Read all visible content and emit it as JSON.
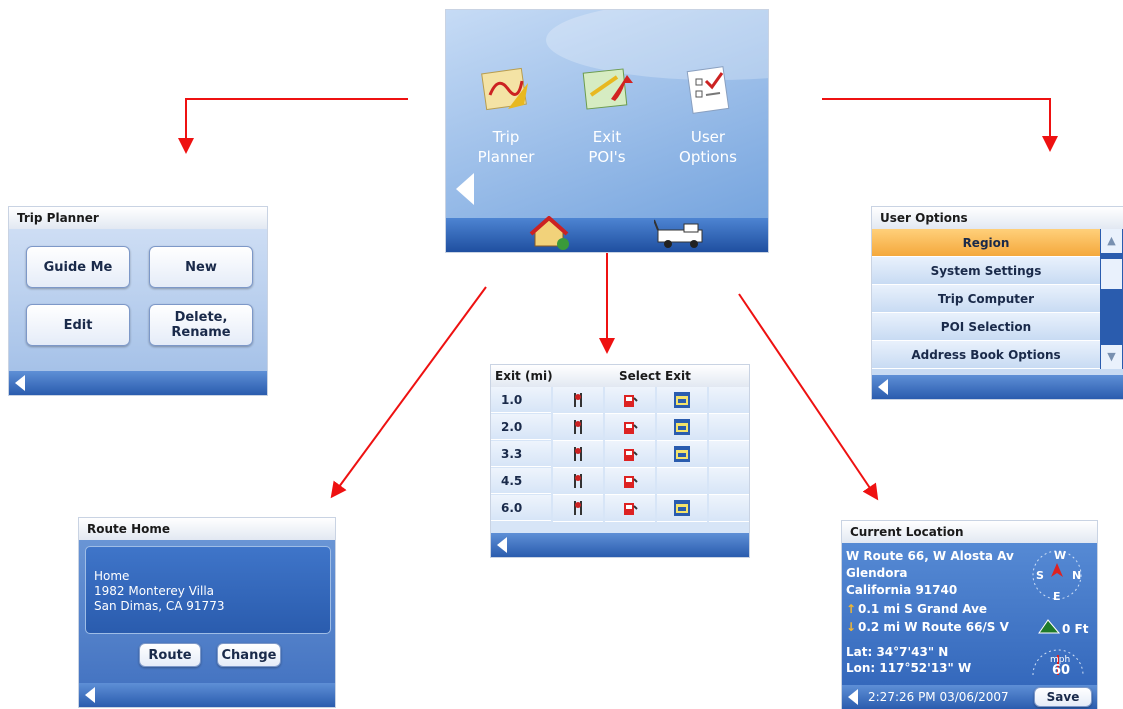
{
  "main_menu": {
    "items": [
      {
        "label": "Trip\nPlanner"
      },
      {
        "label": "Exit\nPOI's"
      },
      {
        "label": "User\nOptions"
      }
    ]
  },
  "trip_planner": {
    "title": "Trip Planner",
    "buttons": [
      "Guide Me",
      "New",
      "Edit",
      "Delete,\nRename"
    ]
  },
  "user_options": {
    "title": "User Options",
    "items": [
      "Region",
      "System Settings",
      "Trip Computer",
      "POI Selection",
      "Address Book Options"
    ]
  },
  "exit_poi": {
    "col_exit": "Exit (mi)",
    "col_select": "Select Exit",
    "rows": [
      {
        "mile": "1.0",
        "food": true,
        "gas": true,
        "lodging": true
      },
      {
        "mile": "2.0",
        "food": true,
        "gas": true,
        "lodging": true
      },
      {
        "mile": "3.3",
        "food": true,
        "gas": true,
        "lodging": true
      },
      {
        "mile": "4.5",
        "food": true,
        "gas": true,
        "lodging": false
      },
      {
        "mile": "6.0",
        "food": true,
        "gas": true,
        "lodging": true
      }
    ]
  },
  "route_home": {
    "title": "Route Home",
    "name": "Home",
    "address1": "1982 Monterey Villa",
    "address2": "San Dimas, CA  91773",
    "btn_route": "Route",
    "btn_change": "Change"
  },
  "current_location": {
    "title": "Current Location",
    "line1": "W Route 66, W Alosta Av",
    "line2": "Glendora",
    "line3": "California 91740",
    "next1": "0.1 mi S Grand Ave",
    "next2": "0.2 mi W Route 66/S V",
    "elevation": "0 Ft",
    "lat": "Lat:  34°7'43\"   N",
    "lon": "Lon:  117°52'13\"   W",
    "speed_unit": "mph",
    "speed": "60",
    "time": "2:27:26 PM  03/06/2007",
    "save": "Save"
  },
  "colors": {
    "arrow": "#ee1111",
    "bar": "#2a5cae",
    "selected": "#f4a83c"
  }
}
